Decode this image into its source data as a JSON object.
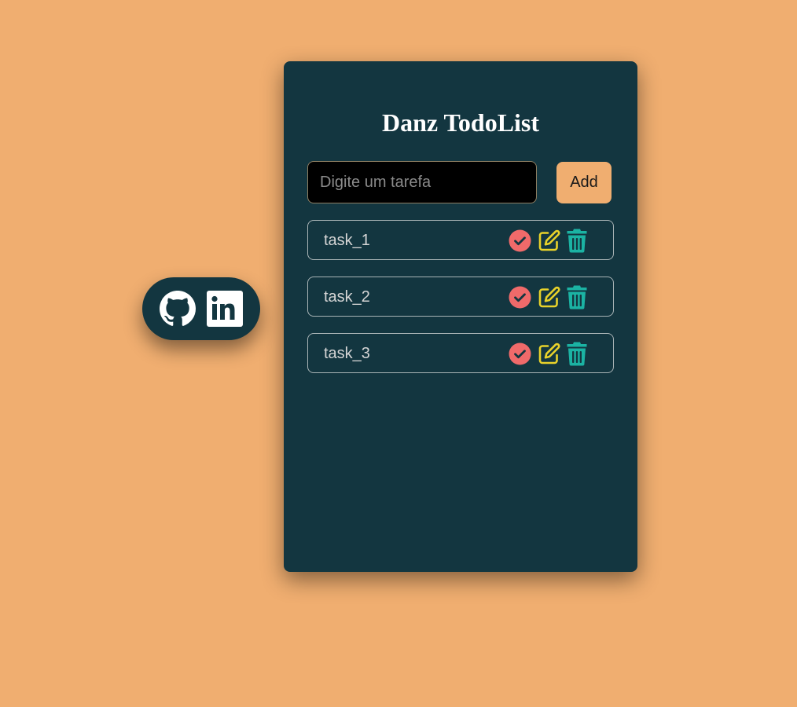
{
  "app": {
    "title": "Danz TodoList"
  },
  "social": {
    "icons": [
      "github-icon",
      "linkedin-icon"
    ]
  },
  "form": {
    "input_value": "",
    "input_placeholder": "Digite um tarefa",
    "add_label": "Add"
  },
  "tasks": [
    {
      "label": "task_1"
    },
    {
      "label": "task_2"
    },
    {
      "label": "task_3"
    }
  ],
  "task_action_icons": [
    "check-circle-icon",
    "edit-icon",
    "trash-icon"
  ],
  "colors": {
    "page_background": "#f0ae70",
    "card_background": "#133640",
    "add_button": "#f0ae70",
    "check_icon": "#f06a6a",
    "edit_icon": "#e8d22a",
    "trash_icon": "#1bb3a3"
  }
}
